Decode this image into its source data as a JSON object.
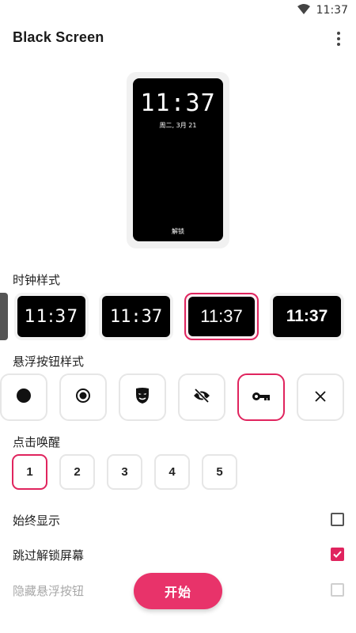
{
  "status": {
    "time": "11:37",
    "icons": [
      "wifi-icon"
    ]
  },
  "app": {
    "title": "Black Screen",
    "menu_icon": "more-vert-icon"
  },
  "preview": {
    "time": "11:37",
    "date": "周二, 3月 21",
    "unlock_label": "解锁"
  },
  "clock_style": {
    "label": "时钟样式",
    "options": [
      {
        "text": "11:37",
        "selected": false
      },
      {
        "text": "11:37",
        "selected": false
      },
      {
        "text": "11:37",
        "selected": true
      },
      {
        "text": "11:37",
        "selected": false
      }
    ]
  },
  "fab_style": {
    "label": "悬浮按钮样式",
    "options": [
      {
        "icon": "filled-circle-icon",
        "selected": false
      },
      {
        "icon": "radio-target-icon",
        "selected": false
      },
      {
        "icon": "mask-icon",
        "selected": false
      },
      {
        "icon": "eye-off-icon",
        "selected": false
      },
      {
        "icon": "key-icon",
        "selected": true
      },
      {
        "icon": "close-icon",
        "selected": false
      }
    ]
  },
  "wake": {
    "label": "点击唤醒",
    "options": [
      {
        "value": "1",
        "selected": true
      },
      {
        "value": "2",
        "selected": false
      },
      {
        "value": "3",
        "selected": false
      },
      {
        "value": "4",
        "selected": false
      },
      {
        "value": "5",
        "selected": false
      }
    ]
  },
  "settings": {
    "always_show": {
      "label": "始终显示",
      "checked": false
    },
    "skip_lock": {
      "label": "跳过解锁屏幕",
      "checked": true
    },
    "hide_fab": {
      "label": "隐藏悬浮按钮",
      "checked": false
    }
  },
  "start_button": {
    "label": "开始"
  },
  "colors": {
    "accent": "#e0245e",
    "button": "#e8336a"
  }
}
